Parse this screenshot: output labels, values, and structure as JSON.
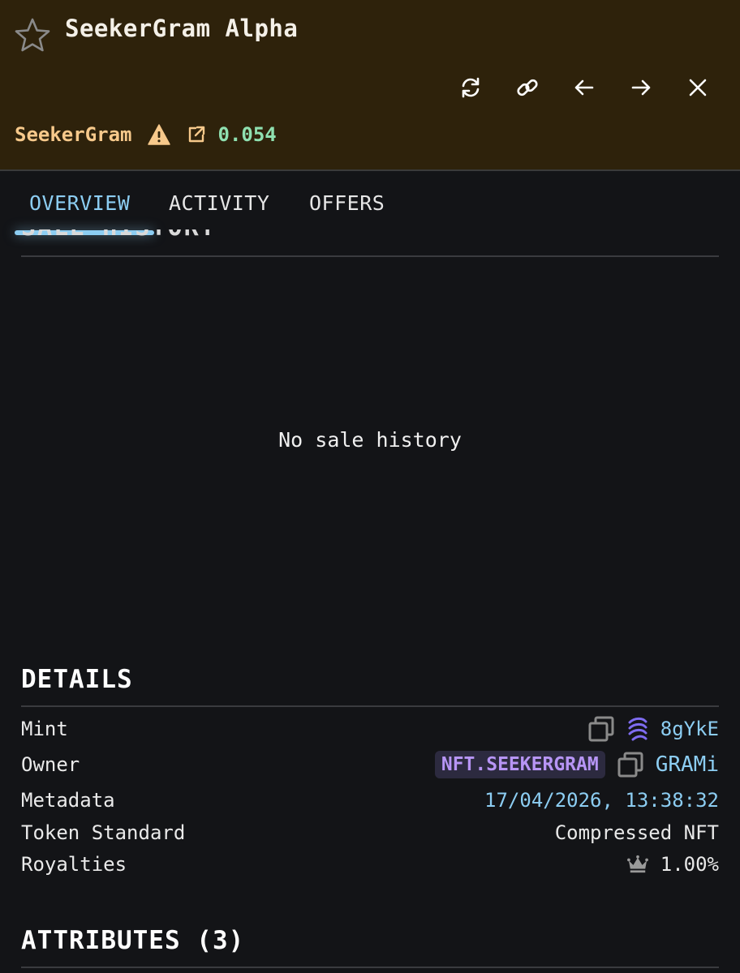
{
  "header": {
    "title": "SeekerGram Alpha",
    "collection": "SeekerGram",
    "price": "0.054",
    "toolbar": [
      "refresh-icon",
      "link-icon",
      "arrow-left-icon",
      "arrow-right-icon",
      "close-icon"
    ]
  },
  "tabs": [
    {
      "label": "OVERVIEW",
      "active": true
    },
    {
      "label": "ACTIVITY",
      "active": false
    },
    {
      "label": "OFFERS",
      "active": false
    }
  ],
  "sale_history": {
    "heading": "SALE HISTORY",
    "empty_text": "No sale history"
  },
  "details": {
    "title": "DETAILS",
    "rows": [
      {
        "label": "Mint",
        "value": "8gYkE"
      },
      {
        "label": "Owner",
        "badge": "NFT.SEEKERGRAM",
        "value": "GRAMi"
      },
      {
        "label": "Metadata",
        "value": "17/04/2026, 13:38:32"
      },
      {
        "label": "Token Standard",
        "value": "Compressed NFT"
      },
      {
        "label": "Royalties",
        "value": "1.00%"
      }
    ]
  },
  "attributes": {
    "title": "ATTRIBUTES (3)"
  },
  "colors": {
    "header_bg": "#2e220b",
    "accent": "#8ccdf2",
    "collection": "#f7c98b",
    "price": "#8fe0b0",
    "badge": "#b795f5"
  }
}
